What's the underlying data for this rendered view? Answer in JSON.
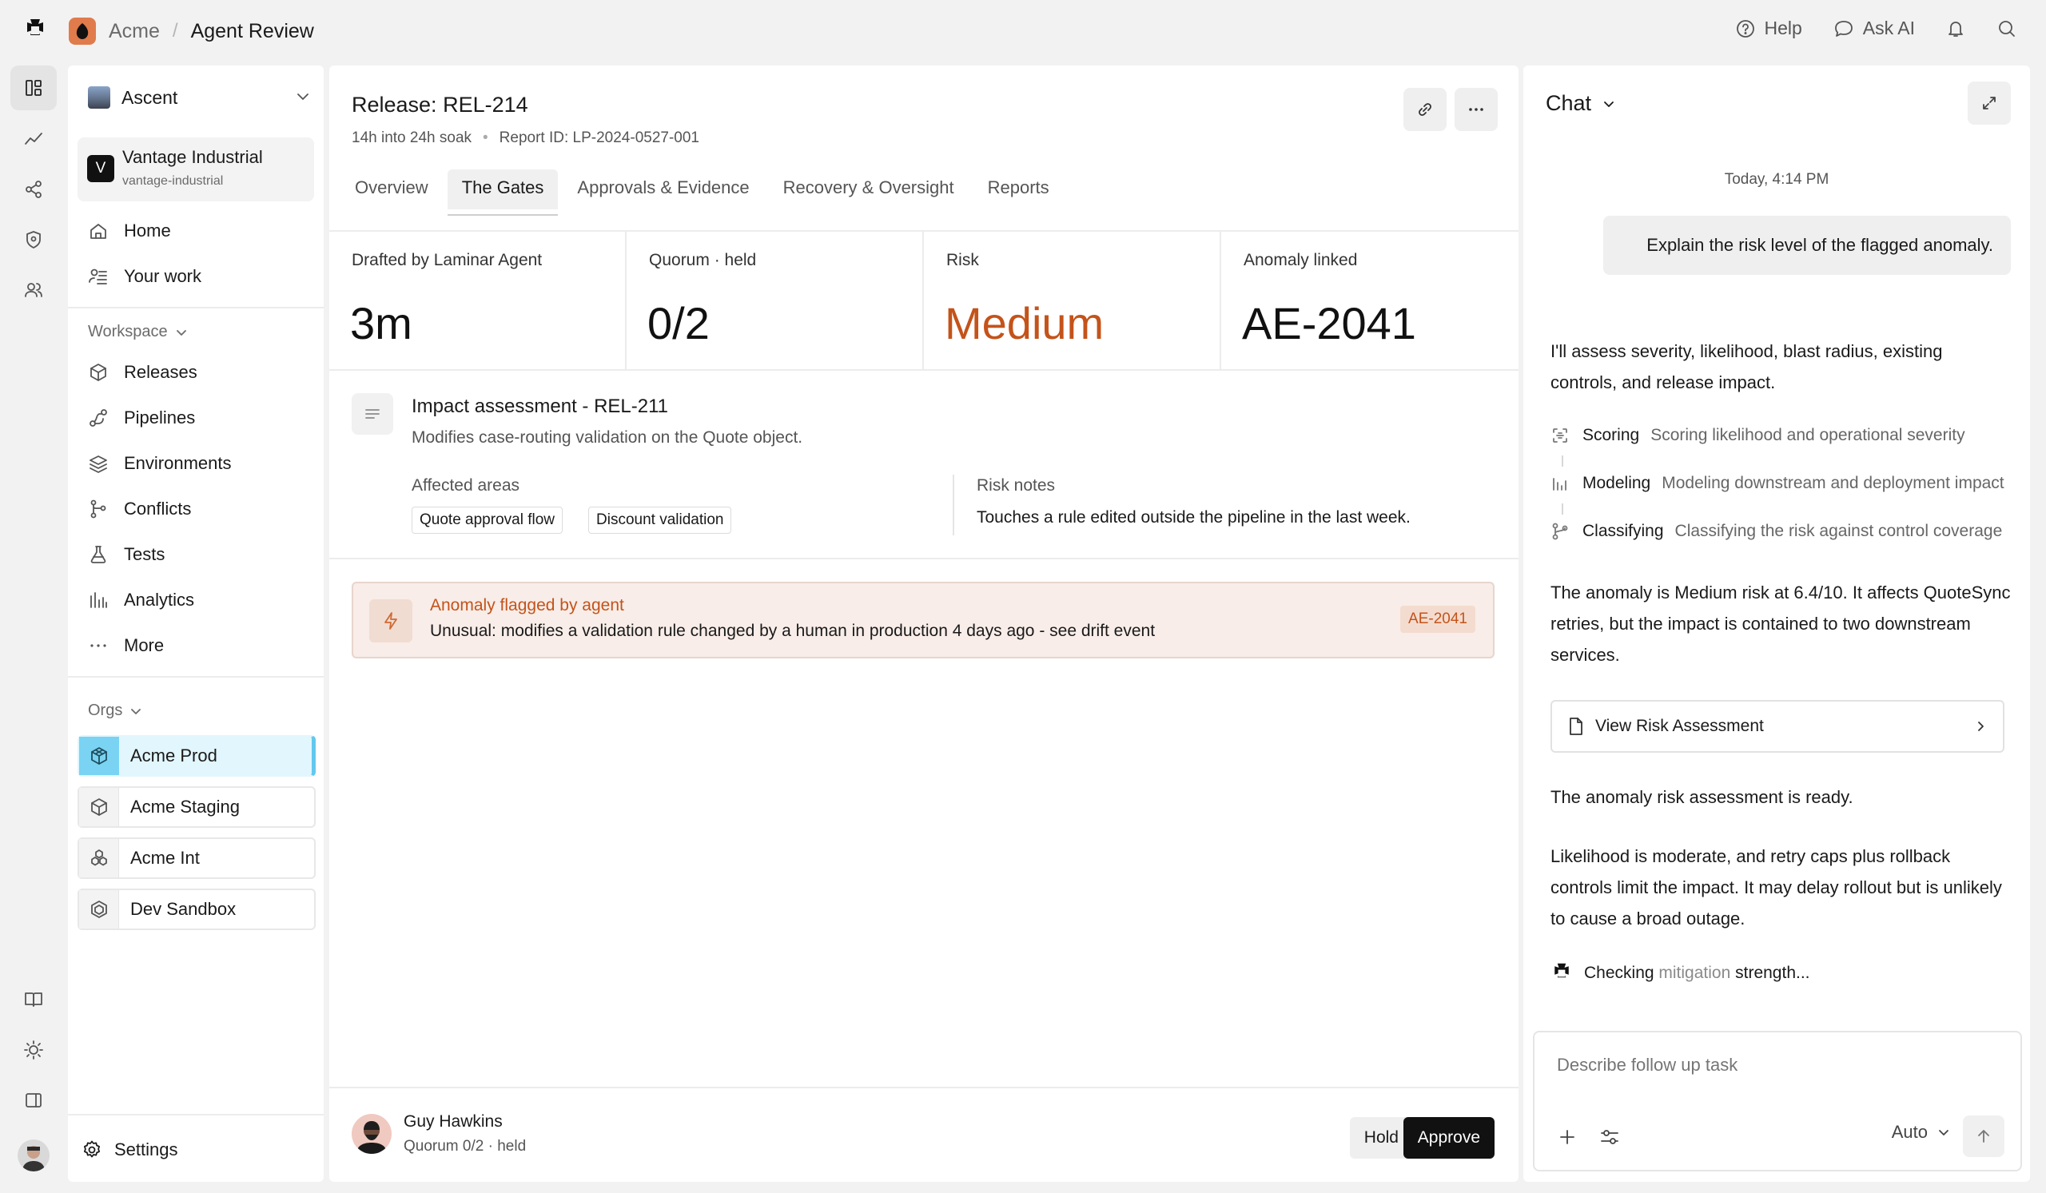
{
  "topbar": {
    "org": "Acme",
    "separator": "/",
    "page": "Agent Review",
    "help": "Help",
    "ask_ai": "Ask AI"
  },
  "sidebar": {
    "workspace": "Ascent",
    "tenant": {
      "initial": "V",
      "name": "Vantage Industrial",
      "slug": "vantage-industrial"
    },
    "primary": [
      {
        "label": "Home",
        "icon": "home-icon"
      },
      {
        "label": "Your work",
        "icon": "your-work-icon"
      }
    ],
    "workspace_header": "Workspace",
    "workspace_items": [
      {
        "label": "Releases",
        "icon": "cube-icon"
      },
      {
        "label": "Pipelines",
        "icon": "pipeline-icon"
      },
      {
        "label": "Environments",
        "icon": "layers-icon"
      },
      {
        "label": "Conflicts",
        "icon": "merge-icon"
      },
      {
        "label": "Tests",
        "icon": "flask-icon"
      },
      {
        "label": "Analytics",
        "icon": "bars-icon"
      },
      {
        "label": "More",
        "icon": "ellipsis-icon"
      }
    ],
    "orgs_header": "Orgs",
    "orgs": [
      {
        "label": "Acme Prod",
        "active": true
      },
      {
        "label": "Acme Staging",
        "active": false
      },
      {
        "label": "Acme Int",
        "active": false
      },
      {
        "label": "Dev Sandbox",
        "active": false
      }
    ],
    "settings": "Settings"
  },
  "main": {
    "title": "Release: REL-214",
    "soak": "14h into 24h soak",
    "meta_sep": "•",
    "report_id": "Report ID: LP-2024-0527-001",
    "tabs": [
      "Overview",
      "The Gates",
      "Approvals & Evidence",
      "Recovery & Oversight",
      "Reports"
    ],
    "active_tab": "The Gates",
    "stats": [
      {
        "label": "Drafted by Laminar Agent",
        "value": "3m"
      },
      {
        "label": "Quorum · held",
        "value": "0/2"
      },
      {
        "label": "Risk",
        "value": "Medium"
      },
      {
        "label": "Anomaly linked",
        "value": "AE-2041"
      }
    ],
    "impact": {
      "title": "Impact assessment - REL-211",
      "description": "Modifies case-routing validation on the Quote object.",
      "affected_label": "Affected areas",
      "areas": [
        "Quote approval flow",
        "Discount validation"
      ],
      "risk_label": "Risk notes",
      "risk_note": "Touches a rule edited outside the pipeline in the last week."
    },
    "alert": {
      "title": "Anomaly flagged by agent",
      "body": "Unusual: modifies a validation rule changed by a human in production 4 days ago - see drift event",
      "badge": "AE-2041"
    },
    "footer": {
      "user": "Guy Hawkins",
      "status": "Quorum 0/2 · held",
      "hold": "Hold",
      "approve": "Approve"
    }
  },
  "chat": {
    "title": "Chat",
    "timestamp": "Today, 4:14 PM",
    "user_message": "Explain the risk level of the flagged anomaly.",
    "intro": "I'll assess severity, likelihood, blast radius, existing controls, and release impact.",
    "steps": [
      {
        "name": "Scoring",
        "desc": "Scoring likelihood and operational severity",
        "icon": "scan-icon"
      },
      {
        "name": "Modeling",
        "desc": "Modeling downstream and deployment impact",
        "icon": "bars-icon"
      },
      {
        "name": "Classifying",
        "desc": "Classifying the risk against control coverage",
        "icon": "branch-icon"
      }
    ],
    "summary": "The anomaly is Medium risk at 6.4/10. It affects QuoteSync retries, but the impact is contained to two downstream services.",
    "card_label": "View Risk Assessment",
    "ready": "The anomaly risk assessment is ready.",
    "detail": "Likelihood is moderate, and retry caps plus rollback controls limit the impact. It may delay rollout but is unlikely to cause a broad outage.",
    "thinking_a": "Checking ",
    "thinking_b": "mitigation",
    "thinking_c": " strength...",
    "placeholder": "Describe follow up task",
    "model": "Auto"
  },
  "colors": {
    "accent": "#c4531a",
    "active_org": "#7ad3f2",
    "alert_bg": "#f8ede8"
  }
}
